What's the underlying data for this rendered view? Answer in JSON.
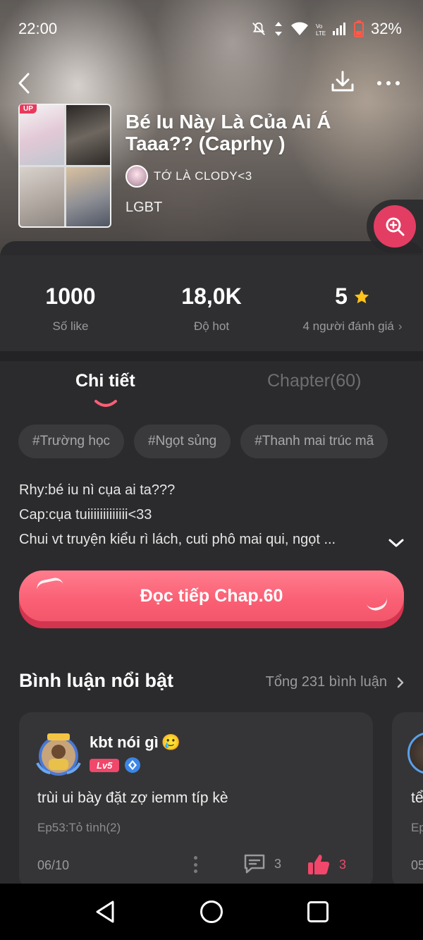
{
  "status_bar": {
    "time": "22:00",
    "battery": "32%"
  },
  "header": {
    "cover_badge": "UP",
    "title": "Bé Iu Này Là Của Ai Á Taaa?? (Caprhy )",
    "author": "TỚ LÀ CLODY<3",
    "genre": "LGBT"
  },
  "stats": {
    "likes_value": "1000",
    "likes_label": "Số like",
    "hot_value": "18,0K",
    "hot_label": "Độ hot",
    "rating_value": "5",
    "rating_label": "4 người đánh giá"
  },
  "tabs": {
    "detail": "Chi tiết",
    "chapters": "Chapter(60)"
  },
  "tags": [
    "#Trường học",
    "#Ngọt sủng",
    "#Thanh mai trúc mã"
  ],
  "description": {
    "line1": "Rhy:bé iu nì cụa ai ta???",
    "line2": "Cap:cụa tuiiiiiiiiiiiii<33",
    "line3": "Chui vt truyện kiểu rì lách, cuti phô mai qui, ngọt ..."
  },
  "read_button": {
    "label": "Đọc tiếp Chap.60"
  },
  "comments": {
    "title": "Bình luận nổi bật",
    "total": "Tổng 231 bình luận",
    "items": [
      {
        "user": "kbt nói gì",
        "emoji": "🥲",
        "level": "Lv5",
        "text": "trùi ui bày đặt zợ iemm típ kè",
        "episode": "Ep53:Tỏ tình(2)",
        "date": "06/10",
        "replies": "3",
        "likes": "3"
      },
      {
        "text": "tể",
        "episode": "Ep",
        "date": "05"
      }
    ]
  },
  "colors": {
    "accent": "#fa5f74",
    "like": "#f0476a",
    "star": "#ffc31a",
    "background": "#2b2b2d"
  },
  "icons": {
    "back": "chevron-left-icon",
    "download": "download-icon",
    "more": "more-horizontal-icon",
    "zoom": "zoom-in-icon",
    "star": "star-icon",
    "reply": "comment-icon",
    "like": "thumbs-up-icon"
  }
}
